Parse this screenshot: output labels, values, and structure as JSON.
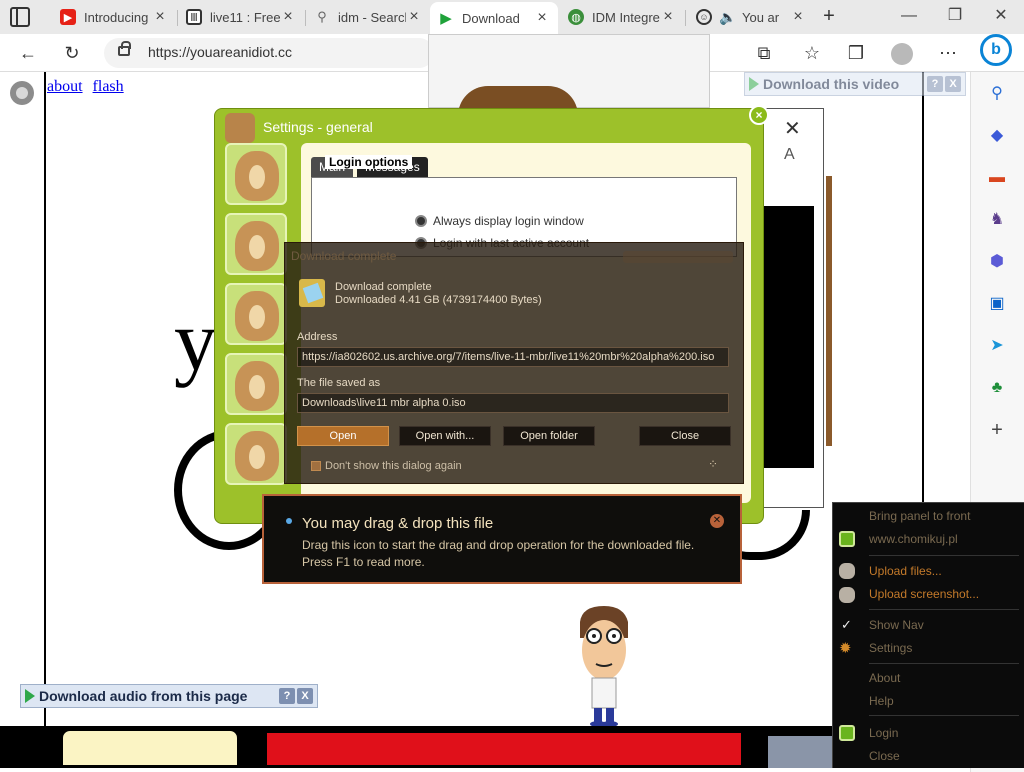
{
  "tabs": [
    {
      "title": "Introducing",
      "icon": "youtube-icon"
    },
    {
      "title": "live11 : Free",
      "icon": "archive-icon"
    },
    {
      "title": "idm - Search",
      "icon": "search-icon"
    },
    {
      "title": "Download",
      "icon": "play-icon"
    },
    {
      "title": "IDM Integre",
      "icon": "globe-icon"
    },
    {
      "title": "You ar",
      "icon": "smiley-icon"
    }
  ],
  "address": {
    "url": "https://youareanidiot.cc"
  },
  "page": {
    "link_about": "about",
    "link_flash": "flash",
    "big_letter": "y"
  },
  "video_bar": {
    "label": "Download this video",
    "help": "?",
    "close": "X"
  },
  "audio_bar": {
    "label": "Download audio from this page",
    "help": "?",
    "close": "X"
  },
  "settings": {
    "title": "Settings - general",
    "tab_main": "Main",
    "tab_messages": "Messages",
    "login_options": "Login options",
    "opt_always": "Always display login window",
    "opt_last": "Login with last active account"
  },
  "dialog": {
    "title": "Download complete",
    "status": "Download complete",
    "downloaded": "Downloaded 4.41 GB (4739174400 Bytes)",
    "address_label": "Address",
    "address_value": "https://ia802602.us.archive.org/7/items/live-11-mbr/live11%20mbr%20alpha%200.iso",
    "saved_label": "The file saved as",
    "saved_value": "Downloads\\live11 mbr alpha 0.iso",
    "btn_open": "Open",
    "btn_open_with": "Open with...",
    "btn_open_folder": "Open folder",
    "btn_close": "Close",
    "dont_show": "Don't show this dialog again"
  },
  "tooltip": {
    "heading": "You may drag & drop this file",
    "line1": "Drag this icon to start the drag and drop operation for the downloaded file.",
    "line2": "Press F1 to read more."
  },
  "context_menu": [
    {
      "label": "Bring panel to front",
      "icon": ""
    },
    {
      "label": "www.chomikuj.pl",
      "icon": "green-square-icon"
    },
    {
      "label": "Upload files...",
      "icon": "rock-icon"
    },
    {
      "label": "Upload screenshot...",
      "icon": "rock-icon"
    },
    {
      "label": "Show Nav",
      "icon": "check-icon"
    },
    {
      "label": "Settings",
      "icon": "gear-icon"
    },
    {
      "label": "About",
      "icon": ""
    },
    {
      "label": "Help",
      "icon": ""
    },
    {
      "label": "Login",
      "icon": "green-square-icon"
    },
    {
      "label": "Close",
      "icon": ""
    }
  ],
  "colors": {
    "settings_green": "#9dc12a",
    "dialog_brown": "#b5702a",
    "tooltip_border": "#b8623a",
    "edge_blue": "#0a84d6"
  }
}
